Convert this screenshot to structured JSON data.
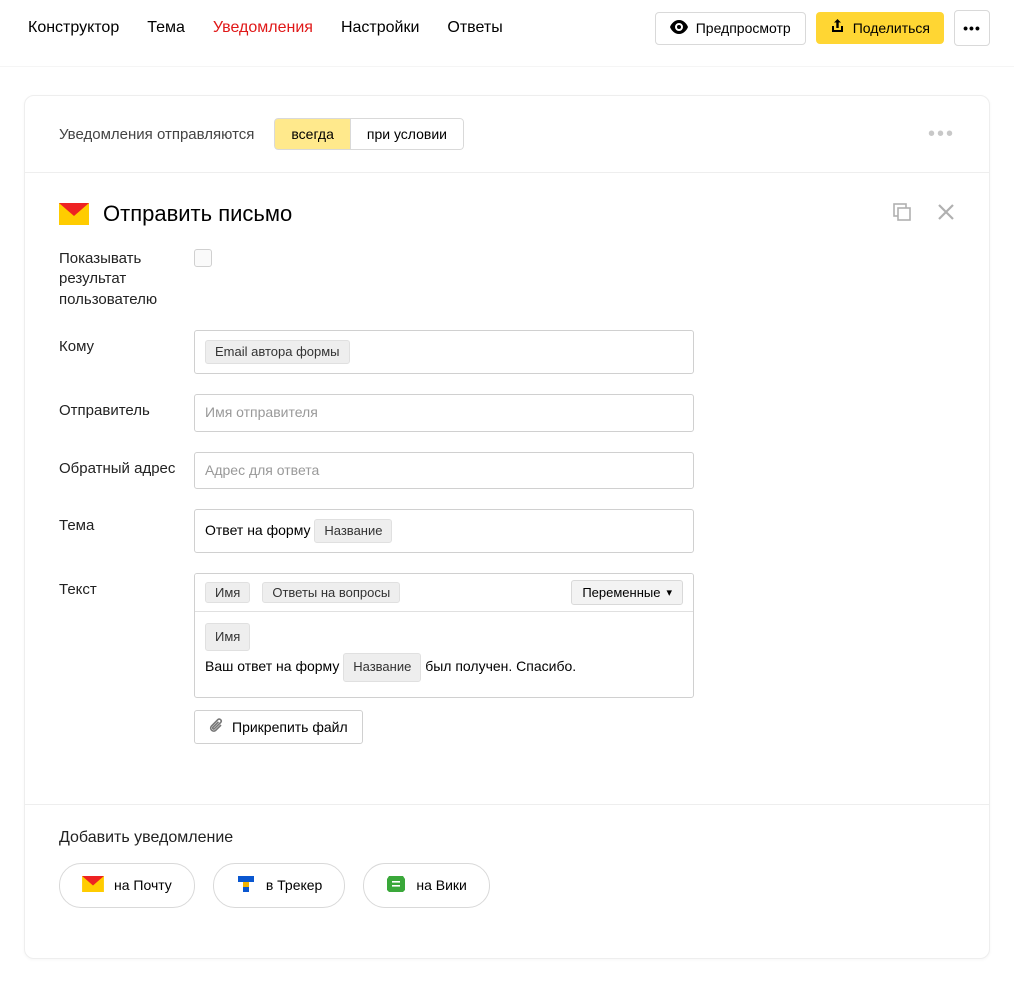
{
  "topbar": {
    "tabs": [
      "Конструктор",
      "Тема",
      "Уведомления",
      "Настройки",
      "Ответы"
    ],
    "active_tab_index": 2,
    "preview": "Предпросмотр",
    "share": "Поделиться",
    "more": "•••"
  },
  "send_conditions": {
    "label": "Уведомления отправляются",
    "options": [
      "всегда",
      "при условии"
    ],
    "active_index": 0,
    "menu": "•••"
  },
  "mail_section": {
    "title": "Отправить письмо",
    "fields": {
      "show_result_label": "Показывать результат пользователю",
      "to_label": "Кому",
      "to_chip": "Email автора формы",
      "sender_label": "Отправитель",
      "sender_placeholder": "Имя отправителя",
      "reply_label": "Обратный адрес",
      "reply_placeholder": "Адрес для ответа",
      "subject_label": "Тема",
      "subject_text": "Ответ на форму ",
      "subject_chip": "Название",
      "body_label": "Текст",
      "body_toolbar_chips": [
        "Имя",
        "Ответы на вопросы"
      ],
      "variables_btn": "Переменные",
      "body_line1_chip": "Имя",
      "body_line2_before": "Ваш ответ на форму ",
      "body_line2_chip": "Название",
      "body_line2_after": " был получен. Спасибо.",
      "attach_label": "Прикрепить файл"
    }
  },
  "add_notification": {
    "title": "Добавить уведомление",
    "buttons": [
      "на Почту",
      "в Трекер",
      "на Вики"
    ]
  }
}
